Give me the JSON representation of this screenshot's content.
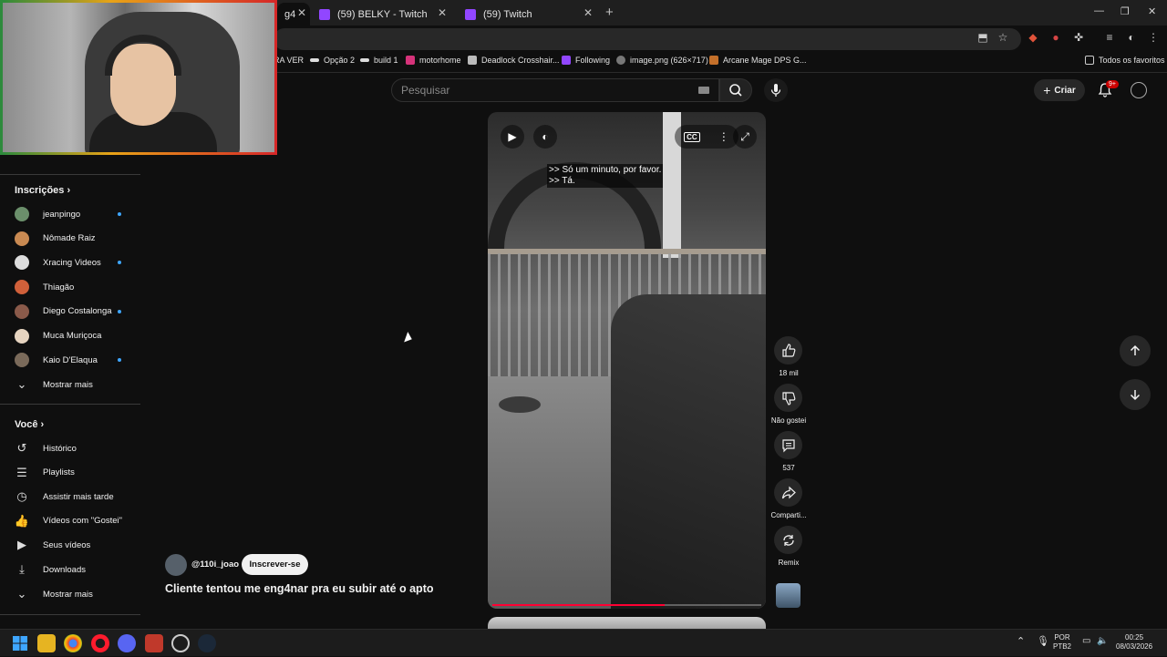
{
  "browser": {
    "tabs": [
      {
        "label": "g4",
        "active": true
      },
      {
        "label": "(59) BELKY - Twitch"
      },
      {
        "label": "(59) Twitch"
      }
    ],
    "new_tab": "+",
    "window_controls": {
      "minimize": "—",
      "maximize": "❐",
      "close": "✕"
    },
    "bookmarks": [
      "RA VER",
      "Opção 2",
      "build 1",
      "motorhome",
      "Deadlock Crosshair...",
      "Following",
      "image.png (626×717)",
      "Arcane Mage DPS G..."
    ],
    "all_bookmarks": "Todos os favoritos"
  },
  "header": {
    "search_placeholder": "Pesquisar",
    "create_label": "Criar",
    "notif_badge": "9+"
  },
  "sidebar": {
    "subscriptions_title": "Inscrições",
    "subscriptions": [
      {
        "label": "jeanpingo",
        "dot": true,
        "color": "#6b8f6b"
      },
      {
        "label": "Nômade Raiz",
        "dot": false,
        "color": "#c98a52"
      },
      {
        "label": "Xracing Videos",
        "dot": true,
        "color": "#dddddd"
      },
      {
        "label": "Thiagão",
        "dot": false,
        "color": "#d0603a"
      },
      {
        "label": "Diego Costalonga",
        "dot": true,
        "color": "#8a5a4a"
      },
      {
        "label": "Muca Muriçoca",
        "dot": false,
        "color": "#e6d4c0"
      },
      {
        "label": "Kaio D'Elaqua",
        "dot": true,
        "color": "#7a6a5a"
      }
    ],
    "show_more_1": "Mostrar mais",
    "you_title": "Você",
    "you_items": [
      {
        "label": "Histórico",
        "icon": "history-icon"
      },
      {
        "label": "Playlists",
        "icon": "playlist-icon"
      },
      {
        "label": "Assistir mais tarde",
        "icon": "clock-icon"
      },
      {
        "label": "Vídeos com \"Gostei\"",
        "icon": "thumbs-up-icon"
      },
      {
        "label": "Seus vídeos",
        "icon": "video-icon"
      },
      {
        "label": "Downloads",
        "icon": "download-icon"
      }
    ],
    "show_more_2": "Mostrar mais"
  },
  "video": {
    "caption_line1": ">> Só um minuto, por favor.",
    "caption_line2": ">> Tá.",
    "cc_label": "CC",
    "progress_fraction": 0.64,
    "channel": "@110i_joao",
    "subscribe_label": "Inscrever-se",
    "title": "Cliente tentou me eng4nar pra eu subir até o apto"
  },
  "actions": {
    "likes": "18 mil",
    "dislike": "Não gostei",
    "comments": "537",
    "share": "Comparti...",
    "remix": "Remix"
  },
  "taskbar": {
    "lang_top": "POR",
    "lang_bottom": "PTB2",
    "time": "00:25",
    "date": "08/03/2026"
  },
  "colors": {
    "accent_red": "#ff0033",
    "twitch_purple": "#9146ff",
    "link_blue": "#3ea6ff"
  }
}
